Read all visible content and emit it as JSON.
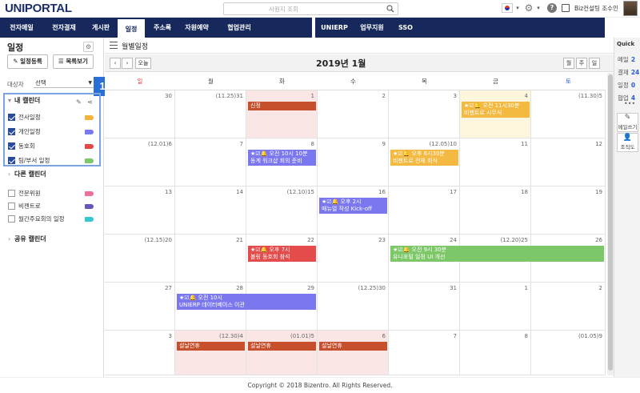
{
  "brand": {
    "logo": "UNIPORTAL"
  },
  "search": {
    "placeholder": "사원지 조회"
  },
  "user": {
    "name": "Biz컨설팅 조수인"
  },
  "nav": {
    "left": [
      "전자메일",
      "전자결재",
      "게시판",
      "일정",
      "주소록",
      "자원예약",
      "협업관리"
    ],
    "right": [
      "UNIERP",
      "업무지원",
      "SSO"
    ],
    "active_index": 3
  },
  "sidebar": {
    "title": "일정",
    "buttons": {
      "register": "일정등록",
      "list": "목록보기"
    },
    "target_label": "대상자",
    "target_value": "선택",
    "badge": "1",
    "my_calendar": {
      "title": "내 캘린더",
      "items": [
        {
          "label": "전사일정",
          "checked": true,
          "color": "#f2b43a"
        },
        {
          "label": "개인일정",
          "checked": true,
          "color": "#7878f0"
        },
        {
          "label": "동호회",
          "checked": true,
          "color": "#e24848"
        },
        {
          "label": "팀/부서 일정",
          "checked": true,
          "color": "#7bc86a"
        }
      ]
    },
    "other_calendar": {
      "title": "다른 캘린더",
      "items": [
        {
          "label": "전문위원",
          "checked": false,
          "color": "#ef6f9c"
        },
        {
          "label": "비젠트로",
          "checked": false,
          "color": "#6a55b8"
        },
        {
          "label": "월간주요회의 일정",
          "checked": false,
          "color": "#35c7cf"
        }
      ]
    },
    "shared_calendar": {
      "title": "공유 캘린더"
    }
  },
  "main": {
    "header": "월별일정",
    "today_btn": "오늘",
    "month_title": "2019년 1월",
    "views": [
      "월",
      "주",
      "일"
    ],
    "weekdays": [
      "일",
      "월",
      "화",
      "수",
      "목",
      "금",
      "토"
    ],
    "weekday_colors": [
      "#e84040",
      "#444",
      "#444",
      "#444",
      "#444",
      "#444",
      "#2a5bd7"
    ],
    "weeks": [
      [
        "30",
        "(11.25)31",
        "1",
        "2",
        "3",
        "4",
        "(11.30)5"
      ],
      [
        "(12.01)6",
        "7",
        "8",
        "9",
        "(12.05)10",
        "11",
        "12"
      ],
      [
        "13",
        "14",
        "(12.10)15",
        "16",
        "17",
        "18",
        "19"
      ],
      [
        "(12.15)20",
        "21",
        "22",
        "23",
        "24",
        "(12.20)25",
        "26"
      ],
      [
        "27",
        "28",
        "29",
        "(12.25)30",
        "31",
        "1",
        "2"
      ],
      [
        "3",
        "(12.30)4",
        "(01.01)5",
        "6",
        "7",
        "8",
        "(01.05)9"
      ]
    ],
    "events": [
      {
        "week": 0,
        "col": 2,
        "span": 1,
        "line1": "신정",
        "line2": "",
        "color": "#c5502b",
        "icons": false
      },
      {
        "week": 0,
        "col": 5,
        "span": 1,
        "line1": "오전 11시30분",
        "line2": "비젠트로 시무식",
        "color": "#f3b940",
        "icons": true
      },
      {
        "week": 1,
        "col": 2,
        "span": 1,
        "line1": "오전 10시 10분",
        "line2": "동계 워크샵 회의 준비",
        "color": "#7b78ef",
        "icons": true
      },
      {
        "week": 1,
        "col": 4,
        "span": 1,
        "line1": "오후 6시30분",
        "line2": "비젠트로 전체 회식",
        "color": "#f3b940",
        "icons": true
      },
      {
        "week": 2,
        "col": 3,
        "span": 1,
        "line1": "오후 2시",
        "line2": "매뉴얼 작성 Kick-off",
        "color": "#7b78ef",
        "icons": true
      },
      {
        "week": 3,
        "col": 2,
        "span": 1,
        "line1": "오후 7시",
        "line2": "볼링 동호회 참석",
        "color": "#e44b4b",
        "icons": true
      },
      {
        "week": 3,
        "col": 4,
        "span": 3,
        "line1": "오전 9시 30분",
        "line2": "유니포털 일정 UI 개선",
        "color": "#7cc767",
        "icons": true
      },
      {
        "week": 4,
        "col": 1,
        "span": 2,
        "line1": "오전 10시",
        "line2": "UNIERP 데이터베이스 이관",
        "color": "#7b78ef",
        "icons": true
      },
      {
        "week": 5,
        "col": 1,
        "span": 1,
        "line1": "설날연휴",
        "line2": "",
        "color": "#c5502b",
        "icons": false
      },
      {
        "week": 5,
        "col": 2,
        "span": 1,
        "line1": "설날연휴",
        "line2": "",
        "color": "#c5502b",
        "icons": false
      },
      {
        "week": 5,
        "col": 3,
        "span": 1,
        "line1": "설날연휴",
        "line2": "",
        "color": "#c5502b",
        "icons": false
      }
    ],
    "today": {
      "week": 0,
      "col": 5
    },
    "holidays": [
      {
        "week": 0,
        "col": 2
      },
      {
        "week": 5,
        "col": 1
      },
      {
        "week": 5,
        "col": 2
      },
      {
        "week": 5,
        "col": 3
      }
    ]
  },
  "quick": {
    "title": "Quick",
    "items": [
      {
        "label": "메일",
        "count": "2"
      },
      {
        "label": "결재",
        "count": "24"
      },
      {
        "label": "일정",
        "count": "0"
      },
      {
        "label": "협업",
        "count": "4"
      }
    ],
    "dots": "•••",
    "buttons": [
      "메일쓰기",
      "조직도"
    ]
  },
  "footer": "Copyright © 2018 Bizentro. All Rights Reserved."
}
